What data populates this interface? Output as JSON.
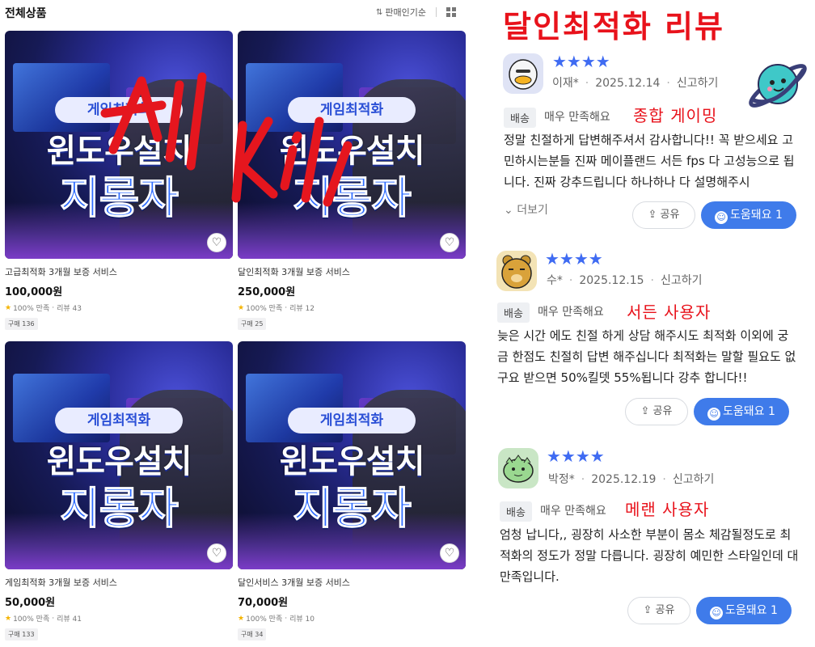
{
  "grid": {
    "title": "전체상품",
    "sort_label": "판매인기순",
    "products": [
      {
        "badge": "게임최적화",
        "line1": "윈도우설치",
        "line2": "지롱자",
        "name": "고급최적화 3개월 보증 서비스",
        "price": "100,000원",
        "satisfaction": "100% 만족",
        "reviews": "리뷰 43",
        "sales": "구매 136"
      },
      {
        "badge": "게임최적화",
        "line1": "윈도우설치",
        "line2": "지롱자",
        "name": "달인최적화 3개월 보증 서비스",
        "price": "250,000원",
        "satisfaction": "100% 만족",
        "reviews": "리뷰 12",
        "sales": "구매 25"
      },
      {
        "badge": "게임최적화",
        "line1": "윈도우설치",
        "line2": "지롱자",
        "name": "게임최적화 3개월 보증 서비스",
        "price": "50,000원",
        "satisfaction": "100% 만족",
        "reviews": "리뷰 41",
        "sales": "구매 133"
      },
      {
        "badge": "게임최적화",
        "line1": "윈도우설치",
        "line2": "지롱자",
        "name": "달인서비스 3개월 보증 서비스",
        "price": "70,000원",
        "satisfaction": "100% 만족",
        "reviews": "리뷰 10",
        "sales": "구매 34"
      }
    ]
  },
  "reviews_panel": {
    "title": "달인최적화 리뷰",
    "more_label": "더보기",
    "share_label": "공유",
    "helpful_label": "도움돼요 1",
    "star_color": "#3f6bf2",
    "accent_red": "#e8121b",
    "button_blue": "#3f7bea",
    "reviews": [
      {
        "stars": "★★★★",
        "author": "이재*",
        "date": "2025.12.14",
        "report": "신고하기",
        "tag": "배송",
        "satisfaction": "매우 만족해요",
        "note": "종합 게이밍",
        "text": "정말 친절하게 답변해주셔서 감사합니다!! 꼭 받으세요 고민하시는분들 진짜 메이플랜드 서든 fps 다 고성능으로 됩니다. 진짜 강추드립니다 하나하나 다 설명해주시"
      },
      {
        "stars": "★★★★",
        "author": "수*",
        "date": "2025.12.15",
        "report": "신고하기",
        "tag": "배송",
        "satisfaction": "매우 만족해요",
        "note": "서든 사용자",
        "text": "늦은 시간 에도 친절 하게 상담 해주시도 최적화 이외에 궁금 한점도 친절히 답변 해주십니다 최적화는 말할 필요도 없구요 받으면 50%킬뎃 55%됩니다 강추 합니다!!"
      },
      {
        "stars": "★★★★",
        "author": "박정*",
        "date": "2025.12.19",
        "report": "신고하기",
        "tag": "배송",
        "satisfaction": "매우 만족해요",
        "note": "메랜 사용자",
        "text": "엄청 납니다,, 굉장히 사소한 부분이 몸소 체감될정도로 최적화의 정도가 정말 다릅니다. 굉장히 예민한 스타일인데 대만족입니다."
      }
    ]
  }
}
